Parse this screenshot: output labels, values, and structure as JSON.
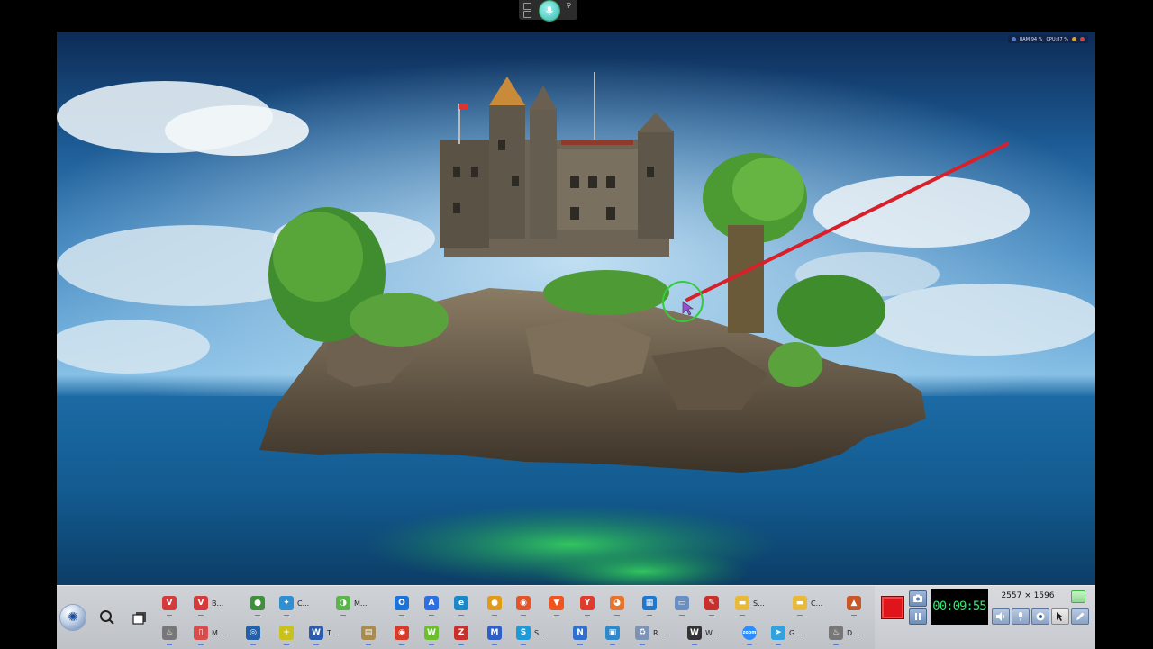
{
  "system_monitor": {
    "ram_label": "RAM:94 %",
    "cpu_label": "CPU:87 %"
  },
  "taskbar": {
    "row1": [
      {
        "name": "vivaldi-icon",
        "label": "",
        "color": "#d63b3b",
        "glyph": "V"
      },
      {
        "name": "vivaldi-icon-2",
        "label": "B...",
        "color": "#d63b3b",
        "glyph": "V"
      },
      {
        "name": "chrome-icon",
        "label": "",
        "color": "#3f8f3f",
        "glyph": "●"
      },
      {
        "name": "app-c-icon",
        "label": "C...",
        "color": "#2f8fd0",
        "glyph": "✦"
      },
      {
        "name": "app-m-icon",
        "label": "M...",
        "color": "#58b64a",
        "glyph": "◑"
      },
      {
        "name": "outlook-icon",
        "label": "",
        "color": "#1a73d9",
        "glyph": "O"
      },
      {
        "name": "app-store-icon",
        "label": "",
        "color": "#2c6fe0",
        "glyph": "A"
      },
      {
        "name": "edge-icon",
        "label": "",
        "color": "#1c88c7",
        "glyph": "e"
      },
      {
        "name": "chrome-canary-icon",
        "label": "",
        "color": "#e09a1c",
        "glyph": "●"
      },
      {
        "name": "firefox-dev-icon",
        "label": "",
        "color": "#e2552a",
        "glyph": "◉"
      },
      {
        "name": "brave-icon",
        "label": "",
        "color": "#f0531c",
        "glyph": "▼"
      },
      {
        "name": "yandex-icon",
        "label": "",
        "color": "#e23b2e",
        "glyph": "Y"
      },
      {
        "name": "firefox-icon",
        "label": "",
        "color": "#e8742c",
        "glyph": "◕"
      },
      {
        "name": "windows-store-icon",
        "label": "",
        "color": "#1e78d0",
        "glyph": "▦"
      },
      {
        "name": "monitor-icon",
        "label": "",
        "color": "#6a8fc3",
        "glyph": "▭"
      },
      {
        "name": "pdf-editor-icon",
        "label": "",
        "color": "#c9302c",
        "glyph": "✎"
      },
      {
        "name": "folder-icon",
        "label": "S...",
        "color": "#e9b93a",
        "glyph": "▬"
      },
      {
        "name": "folder-icon-2",
        "label": "C...",
        "color": "#e9b93a",
        "glyph": "▬"
      },
      {
        "name": "image-viewer-icon",
        "label": "",
        "color": "#c7582a",
        "glyph": "▲"
      }
    ],
    "row2": [
      {
        "name": "flame-icon",
        "label": "",
        "color": "#777",
        "glyph": "♨"
      },
      {
        "name": "device-icon",
        "label": "M...",
        "color": "#d74d4d",
        "glyph": "▯"
      },
      {
        "name": "cortana-icon",
        "label": "",
        "color": "#2260a8",
        "glyph": "◎"
      },
      {
        "name": "plus-app-icon",
        "label": "",
        "color": "#c9c21e",
        "glyph": "+"
      },
      {
        "name": "word-icon",
        "label": "T...",
        "color": "#2a5cad",
        "glyph": "W"
      },
      {
        "name": "archive-icon",
        "label": "",
        "color": "#a98b50",
        "glyph": "▤"
      },
      {
        "name": "record-icon",
        "label": "",
        "color": "#d73a2a",
        "glyph": "◉"
      },
      {
        "name": "whatsapp-icon",
        "label": "",
        "color": "#6bbf2d",
        "glyph": "W"
      },
      {
        "name": "filezilla-icon",
        "label": "",
        "color": "#c9302c",
        "glyph": "Z"
      },
      {
        "name": "maxthon-icon",
        "label": "",
        "color": "#2f5fc9",
        "glyph": "M"
      },
      {
        "name": "skype-icon",
        "label": "S...",
        "color": "#1f9ad6",
        "glyph": "S"
      },
      {
        "name": "notes-icon",
        "label": "",
        "color": "#2f6fd0",
        "glyph": "N"
      },
      {
        "name": "print-icon",
        "label": "",
        "color": "#2f88c9",
        "glyph": "▣"
      },
      {
        "name": "recycle-icon",
        "label": "R...",
        "color": "#7c93b6",
        "glyph": "♻"
      },
      {
        "name": "wordpress-icon",
        "label": "W...",
        "color": "#333",
        "glyph": "W"
      },
      {
        "name": "zoom-icon",
        "label": "",
        "color": "#2d8cff",
        "glyph": "zoom"
      },
      {
        "name": "telegram-icon",
        "label": "G...",
        "color": "#2fa3e0",
        "glyph": "➤"
      },
      {
        "name": "flame-icon-2",
        "label": "D...",
        "color": "#777",
        "glyph": "♨"
      }
    ]
  },
  "recorder": {
    "timer": "00:09:55",
    "resolution": "2557 × 1596"
  }
}
